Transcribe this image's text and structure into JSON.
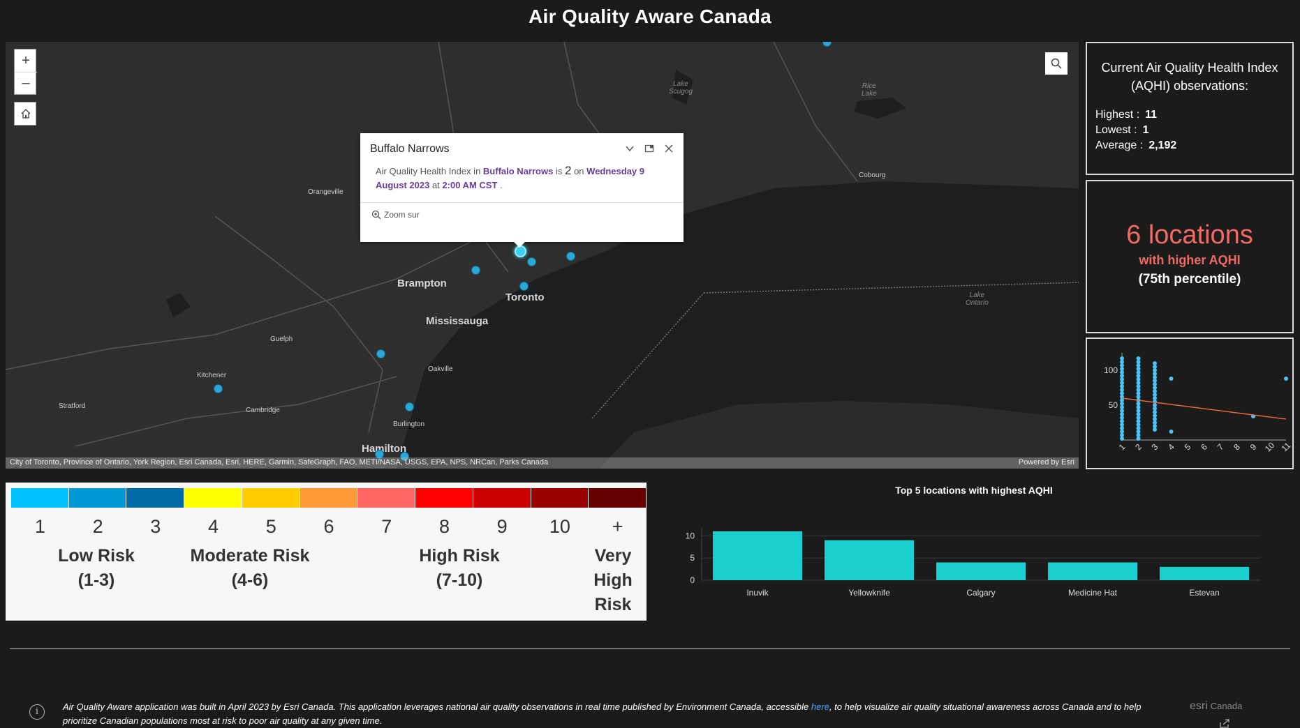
{
  "app": {
    "title": "Air Quality Aware Canada"
  },
  "map": {
    "zoom_in": "+",
    "zoom_out": "–",
    "home_icon": "home-icon",
    "search_icon": "search-icon",
    "attribution": "City of Toronto, Province of Ontario, York Region, Esri Canada, Esri, HERE, Garmin, SafeGraph, FAO, METI/NASA, USGS, EPA, NPS, NRCan, Parks Canada",
    "powered_by": "Powered by Esri",
    "labels": {
      "brampton": "Brampton",
      "toronto": "Toronto",
      "mississauga": "Mississauga",
      "hamilton": "Hamilton",
      "orangeville": "Orangeville",
      "guelph": "Guelph",
      "kitchener": "Kitchener",
      "cambridge": "Cambridge",
      "stratford": "Stratford",
      "oakville": "Oakville",
      "burlington": "Burlington",
      "cobourg": "Cobourg",
      "lake_scugog": "Lake\nScugog",
      "rice_lake": "Rice\nLake",
      "lake_ontario": "Lake\nOntario"
    },
    "popup": {
      "title": "Buffalo Narrows",
      "text_prefix": "Air Quality Health Index in",
      "location": "Buffalo Narrows",
      "is": "is",
      "value": "2",
      "on": "on",
      "date": "Wednesday 9 August 2023",
      "at": "at",
      "time": "2:00 AM CST",
      "zoom_label": "Zoom sur"
    }
  },
  "stats": {
    "heading": "Current Air Quality Health Index (AQHI) observations:",
    "highest_label": "Highest :",
    "highest": "11",
    "lowest_label": "Lowest :",
    "lowest": "1",
    "average_label": "Average :",
    "average": "2,192"
  },
  "count_panel": {
    "number": "6 locations",
    "line1": "with higher AQHI",
    "line2": "(75th percentile)"
  },
  "scatter": {
    "y_ticks": [
      "100",
      "50"
    ],
    "x_ticks": [
      "1",
      "2",
      "3",
      "4",
      "5",
      "6",
      "7",
      "8",
      "9",
      "10",
      "11"
    ]
  },
  "legend": {
    "colors": [
      "#00c2ff",
      "#0099d6",
      "#006aa6",
      "#ffff00",
      "#ffcc00",
      "#ff9933",
      "#ff6666",
      "#ff0000",
      "#cc0000",
      "#990000",
      "#660000"
    ],
    "numbers": [
      "1",
      "2",
      "3",
      "4",
      "5",
      "6",
      "7",
      "8",
      "9",
      "10",
      "+"
    ],
    "low": "Low Risk\n(1-3)",
    "moderate": "Moderate Risk\n(4-6)",
    "high": "High Risk\n(7-10)",
    "very_high": "Very\nHigh\nRisk"
  },
  "chart_data": {
    "type": "bar",
    "title": "Top 5 locations with highest AQHI",
    "categories": [
      "Inuvik",
      "Yellowknife",
      "Calgary",
      "Medicine Hat",
      "Estevan"
    ],
    "values": [
      11,
      9,
      4,
      4,
      3
    ],
    "ylim": [
      0,
      11
    ],
    "yticks": [
      0,
      5,
      10
    ],
    "color": "#1ccfcf"
  },
  "footer": {
    "text_before": "Air Quality Aware application was built in April 2023 by Esri Canada. This application leverages national air quality observations in real time published by Environment Canada, accessible ",
    "link": "here",
    "text_after": ", to help visualize air quality situational awareness across Canada and to help prioritize Canadian populations most at risk to poor air quality at any given time.",
    "brand": "esri",
    "brand_suffix": "Canada"
  }
}
